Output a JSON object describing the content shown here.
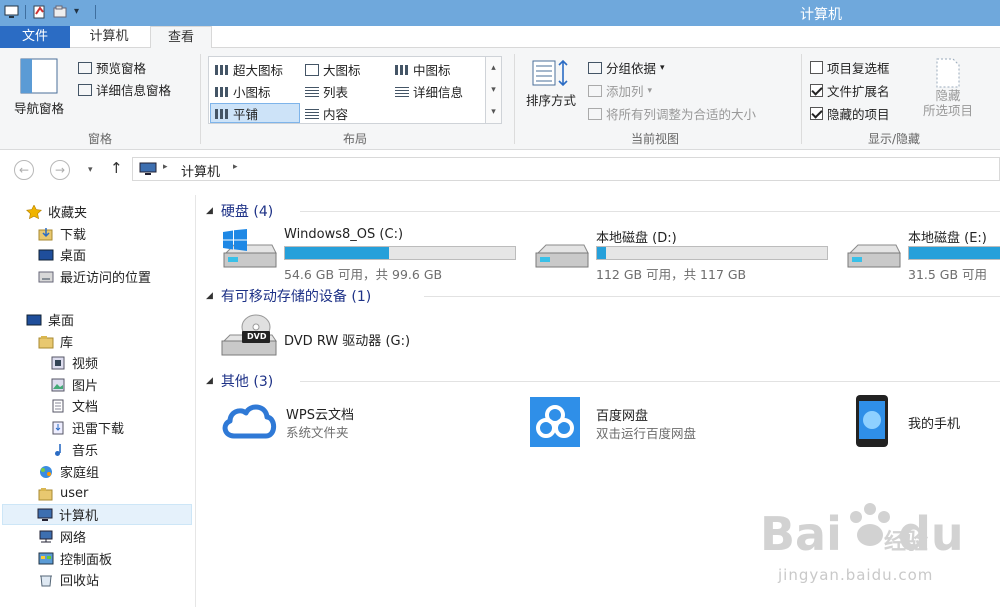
{
  "window": {
    "title": "计算机"
  },
  "ribbon_tabs": [
    "文件",
    "计算机",
    "查看"
  ],
  "ribbon": {
    "pane": {
      "nav_pane": "导航窗格",
      "preview_pane": "预览窗格",
      "details_pane": "详细信息窗格",
      "group_label": "窗格"
    },
    "layout": {
      "items": [
        "超大图标",
        "大图标",
        "中图标",
        "小图标",
        "列表",
        "详细信息",
        "平铺",
        "内容"
      ],
      "selected": "平铺",
      "group_label": "布局"
    },
    "current_view": {
      "sort_by": "排序方式",
      "group_by": "分组依据",
      "add_columns": "添加列",
      "fit_columns": "将所有列调整为合适的大小",
      "group_label": "当前视图"
    },
    "show_hide": {
      "item_checkboxes": "项目复选框",
      "item_checkboxes_checked": false,
      "file_extensions": "文件扩展名",
      "file_extensions_checked": true,
      "hidden_items": "隐藏的项目",
      "hidden_items_checked": true,
      "hide_selected_1": "隐藏",
      "hide_selected_2": "所选项目",
      "group_label": "显示/隐藏"
    }
  },
  "address": {
    "location": "计算机"
  },
  "sidebar": {
    "favorites": "收藏夹",
    "fav_items": [
      "下载",
      "桌面",
      "最近访问的位置"
    ],
    "desktop": "桌面",
    "library": "库",
    "lib_items": [
      "视频",
      "图片",
      "文档",
      "迅雷下载",
      "音乐"
    ],
    "homegroup": "家庭组",
    "user": "user",
    "computer": "计算机",
    "network": "网络",
    "control_panel": "控制面板",
    "recycle_bin": "回收站"
  },
  "sections": {
    "hard_disks": "硬盘 (4)",
    "removable": "有可移动存储的设备 (1)",
    "other": "其他 (3)"
  },
  "drives": [
    {
      "name": "Windows8_OS (C:)",
      "free": "54.6 GB 可用，共 99.6 GB",
      "used_fraction": 0.45
    },
    {
      "name": "本地磁盘 (D:)",
      "free": "112 GB 可用，共 117 GB",
      "used_fraction": 0.04
    },
    {
      "name": "本地磁盘 (E:)",
      "free": "31.5 GB 可用",
      "used_fraction": 0.4
    }
  ],
  "dvd": {
    "name": "DVD RW 驱动器 (G:)",
    "badge": "DVD"
  },
  "other_items": [
    {
      "name": "WPS云文档",
      "sub": "系统文件夹"
    },
    {
      "name": "百度网盘",
      "sub": "双击运行百度网盘"
    },
    {
      "name": "我的手机",
      "sub": ""
    }
  ],
  "watermark": {
    "url": "jingyan.baidu.com"
  },
  "colors": {
    "accent": "#2b6cc4",
    "titlebar": "#6fa8dc",
    "header_blue": "#1e3287",
    "bar_fill": "#26a0da"
  }
}
